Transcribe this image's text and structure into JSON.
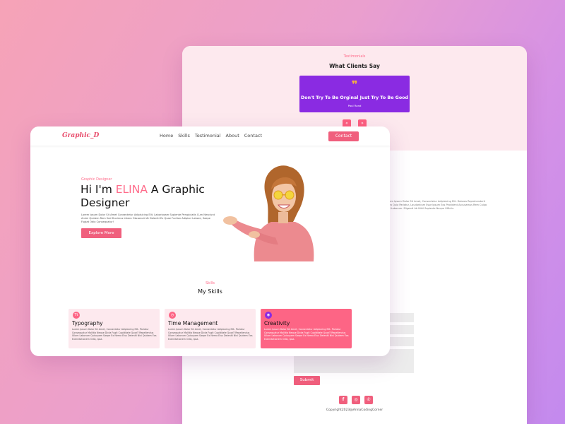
{
  "back": {
    "testimonials": {
      "kicker": "Testimonials",
      "title": "What Clients Say",
      "quote_mark": "❞",
      "quote": "Don't Try To Be Orginal Just Try To Be Good",
      "author": "Paul Rand",
      "prev_icon": "«",
      "next_icon": "»"
    },
    "contact_paragraph": "Lorem Ipsum Dolor Sit Amet, Consectetur Adipisicing Elit. Dolores Reprehenderit Porro Quia Pariatur, Laudantium Esse Ipsum Eos Provident Accusamus Rem Culpa Sed Laborum. Eligendi Ab Nihil Sapiente Neque Officiis.",
    "submit_label": "Submit",
    "social": [
      "f",
      "◎",
      "✆"
    ],
    "copyright": "Copyright2023@AnnaCodingCorner"
  },
  "front": {
    "logo": "Graphic_D",
    "nav": [
      "Home",
      "Skills",
      "Testimonial",
      "About",
      "Contact"
    ],
    "contact_label": "Contact",
    "hero": {
      "kicker": "Graphic Designer",
      "title_prefix": "Hi I'm ",
      "title_highlight": "ELINA",
      "title_suffix": " A Graphic Designer",
      "description": "Lorem Ipsum Dolor Sit Amet Consectetur Adipisicing Elit. Laboriosam Sapiente Perspiciatis Cum Nesciunt Animi Quidem Rem Sed Ducimus Libero Obcaecati At Deleniti Ex Quae Fuction Adipisci Labore, Saepe Fugiat Odio Consequatur!",
      "cta_label": "Explore More"
    },
    "skills": {
      "kicker": "Skills",
      "title": "My Skills",
      "cards": [
        {
          "icon": "Tt",
          "title": "Typography",
          "text": "Lorem Ipsum Dolor Sit Amet, Consectetur Adipisicing Elit. Pariatur Consequatur Mollitia Neque Dicta Fugit Cupiditate Quod? Repellendus Ullam Laborum Quisquam Saepe Ex Nemo Eius Deleniti Nisi Quidem Eos Exercitationem Odio, Ipsa."
        },
        {
          "icon": "◷",
          "title": "Time Management",
          "text": "Lorem Ipsum Dolor Sit Amet, Consectetur Adipisicing Elit. Pariatur Consequatur Mollitia Neque Dicta Fugit Cupiditate Quod? Repellendus Ullam Laborum Quisquam Saepe Ex Nemo Eius Deleniti Nisi Quidem Eos Exercitationem Odio, Ipsa."
        },
        {
          "icon": "◉",
          "title": "Creativity",
          "text": "Lorem Ipsum Dolor Sit Amet, Consectetur Adipisicing Elit. Pariatur Consequatur Mollitia Neque Dicta Fugit Cupiditate Quod? Repellendus Ullam Laborum Quisquam Saepe Ex Nemo Eius Deleniti Nisi Quidem Eos Exercitationem Odio, Ipsa."
        }
      ]
    }
  },
  "colors": {
    "accent": "#f05f7d",
    "purple": "#8a2be2",
    "quote_yellow": "#f6b53c"
  }
}
